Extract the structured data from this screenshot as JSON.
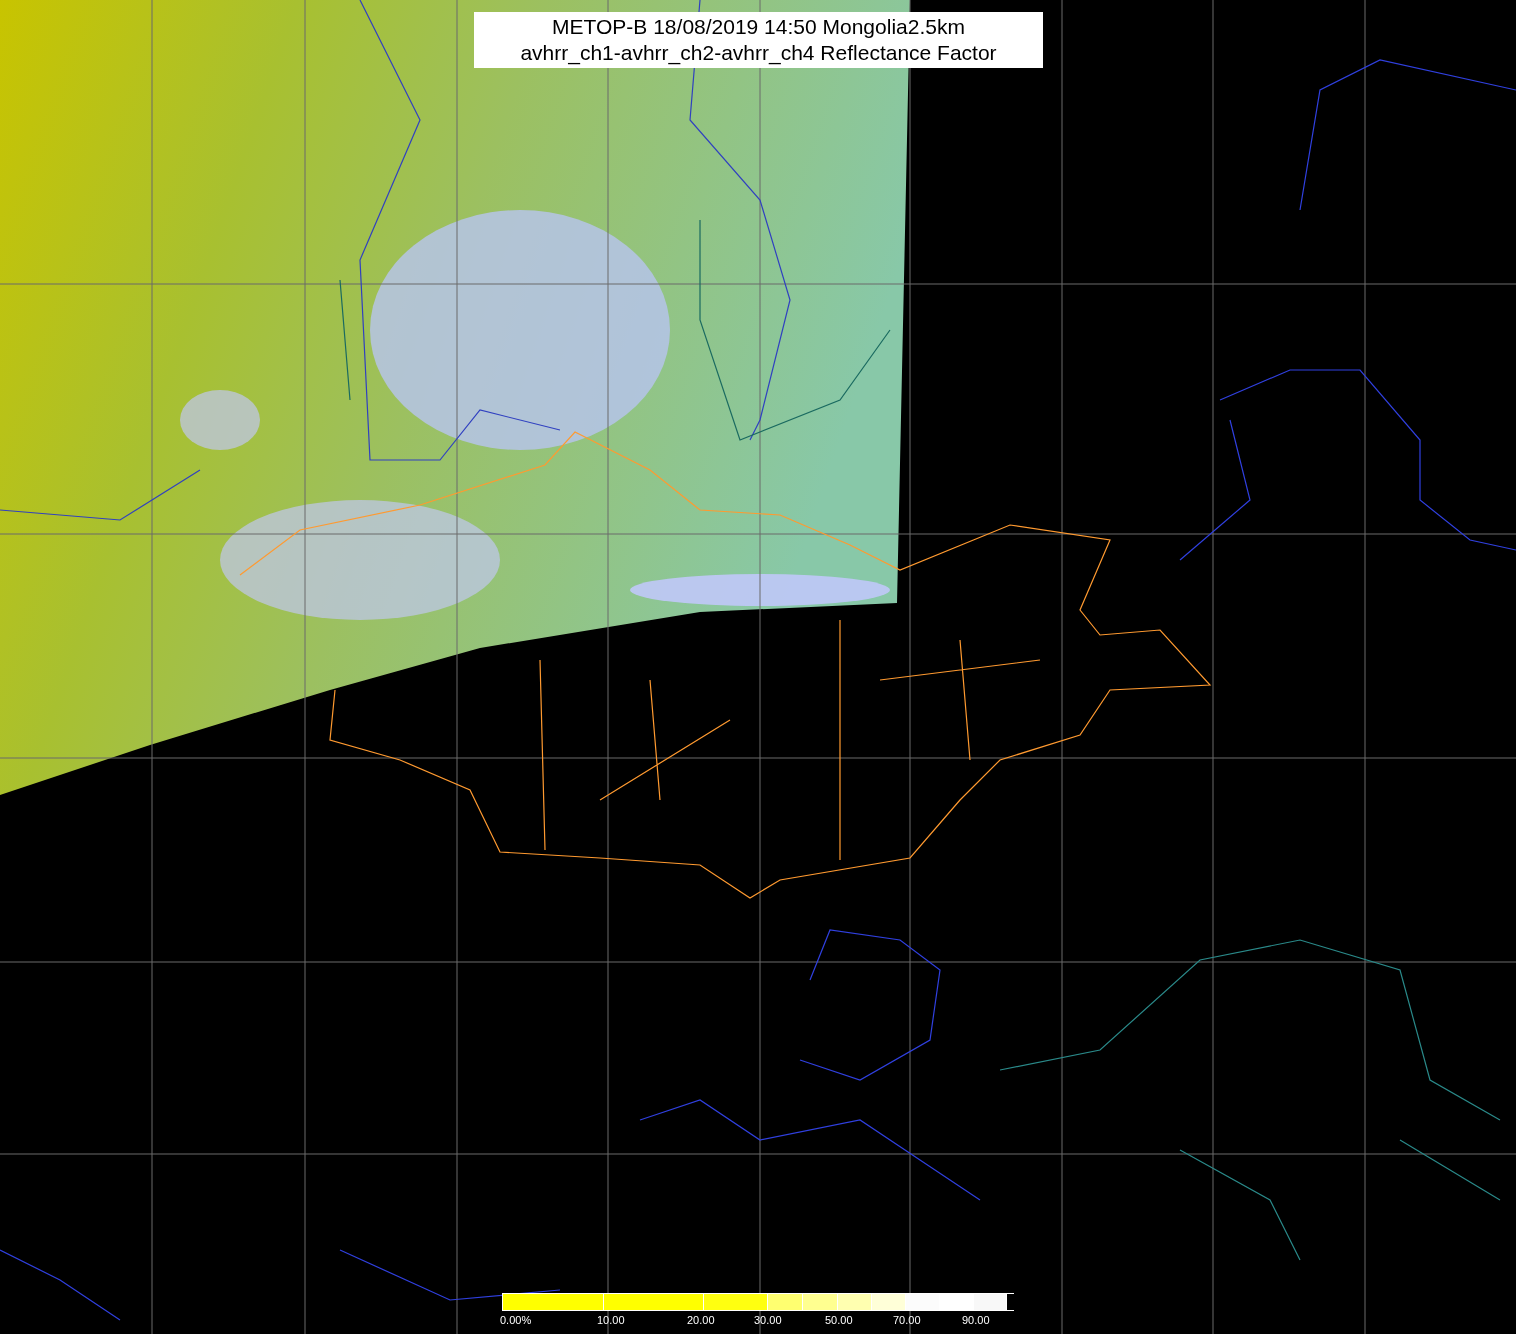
{
  "title": {
    "lines": [
      "METOP-B 18/08/2019 14:50 Mongolia2.5km",
      "avhrr_ch1-avhrr_ch2-avhrr_ch4 Reflectance Factor"
    ]
  },
  "colorbar": {
    "labels": [
      "0.00%",
      "10.00",
      "20.00",
      "30.00",
      "50.00",
      "70.00",
      "90.00"
    ]
  }
}
